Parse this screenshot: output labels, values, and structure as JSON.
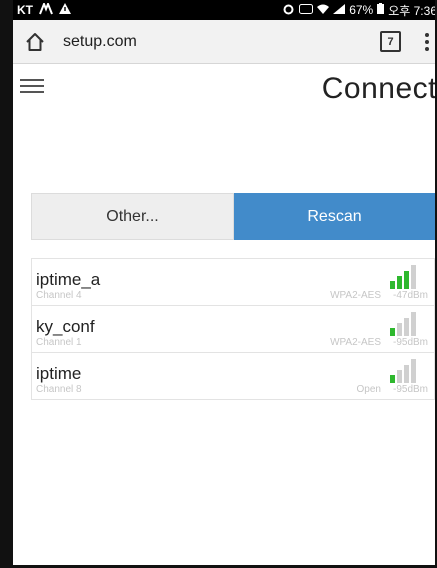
{
  "status_bar": {
    "carrier": "KT",
    "battery": "67%",
    "time": "오후 7:36"
  },
  "browser": {
    "url": "setup.com",
    "tab_count": "7"
  },
  "page": {
    "title": "Connect"
  },
  "buttons": {
    "other_label": "Other...",
    "rescan_label": "Rescan"
  },
  "colors": {
    "accent": "#428bca",
    "signal_active": "#2eb82e",
    "signal_inactive": "#d0d0d0"
  },
  "networks": [
    {
      "ssid": "iptime_a",
      "channel": "Channel 4",
      "security": "WPA2-AES",
      "dbm": "-47dBm",
      "signal_level": 3
    },
    {
      "ssid": "ky_conf",
      "channel": "Channel 1",
      "security": "WPA2-AES",
      "dbm": "-95dBm",
      "signal_level": 1
    },
    {
      "ssid": "iptime",
      "channel": "Channel 8",
      "security": "Open",
      "dbm": "-95dBm",
      "signal_level": 1
    }
  ]
}
